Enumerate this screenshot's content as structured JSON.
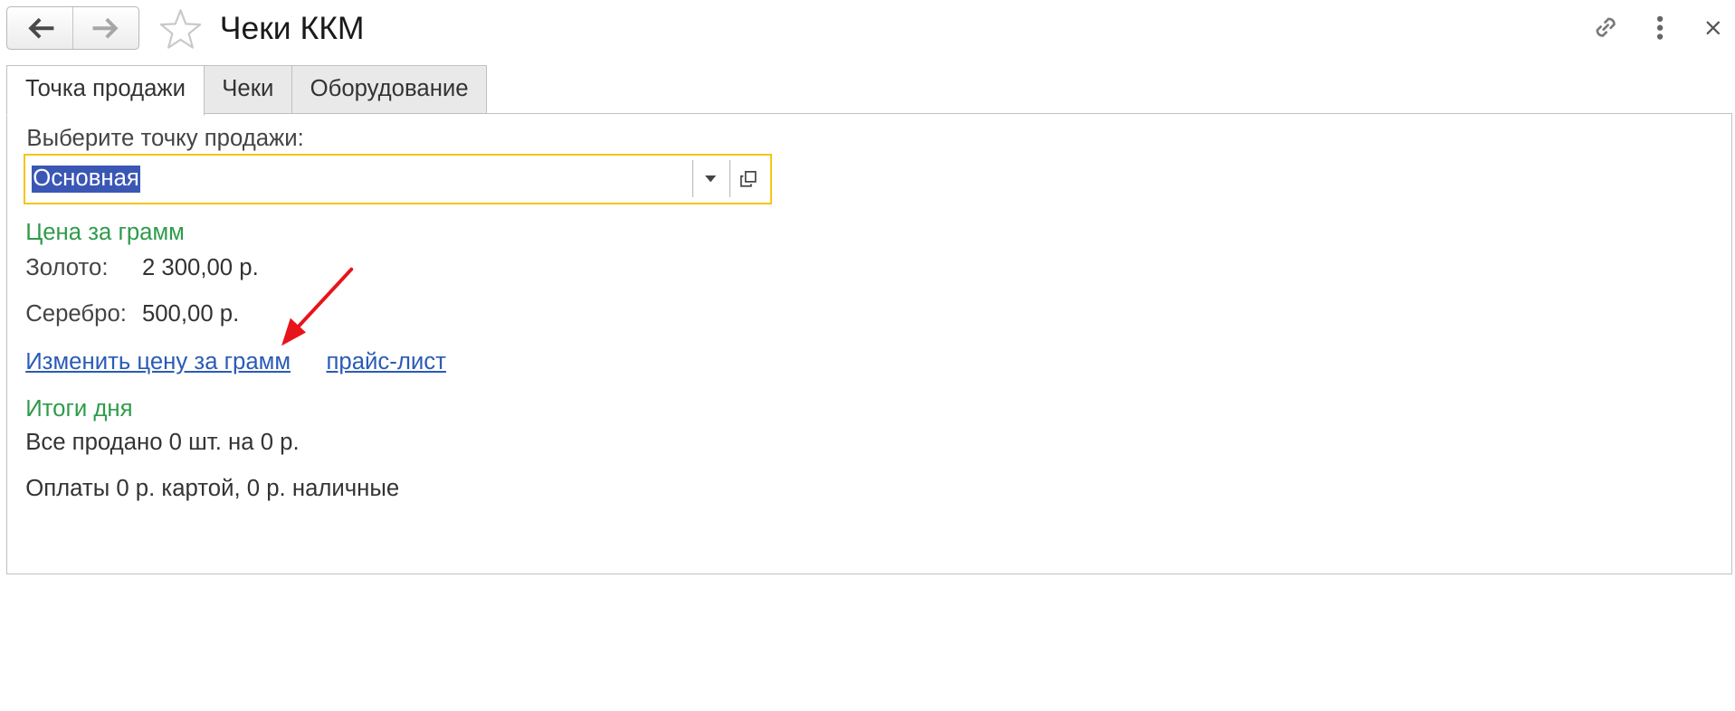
{
  "window": {
    "title": "Чеки ККМ"
  },
  "tabs": [
    {
      "label": "Точка продажи",
      "active": true
    },
    {
      "label": "Чеки",
      "active": false
    },
    {
      "label": "Оборудование",
      "active": false
    }
  ],
  "sale_point": {
    "label": "Выберите точку продажи:",
    "value": "Основная"
  },
  "price_per_gram": {
    "title": "Цена за грамм",
    "gold_label": "Золото:",
    "gold_value": "2 300,00 р.",
    "silver_label": "Серебро:",
    "silver_value": "500,00 р."
  },
  "links": {
    "change_price": "Изменить цену за грамм",
    "price_list": "прайс-лист"
  },
  "day_totals": {
    "title": "Итоги дня",
    "sold": "Все продано 0 шт. на 0 р.",
    "payments": "Оплаты 0 р. картой, 0 р. наличные"
  },
  "colors": {
    "accent_green": "#2e9b4a",
    "link_blue": "#2a5bb5",
    "focus_yellow": "#f5c518",
    "selection_blue": "#3b57b5",
    "annotation_red": "#e8141b"
  },
  "icons": {
    "back": "arrow-left-icon",
    "forward": "arrow-right-icon",
    "favorite": "star-icon",
    "link": "link-icon",
    "more": "more-vertical-icon",
    "close": "close-icon",
    "dropdown": "chevron-down-icon",
    "open": "open-window-icon"
  }
}
